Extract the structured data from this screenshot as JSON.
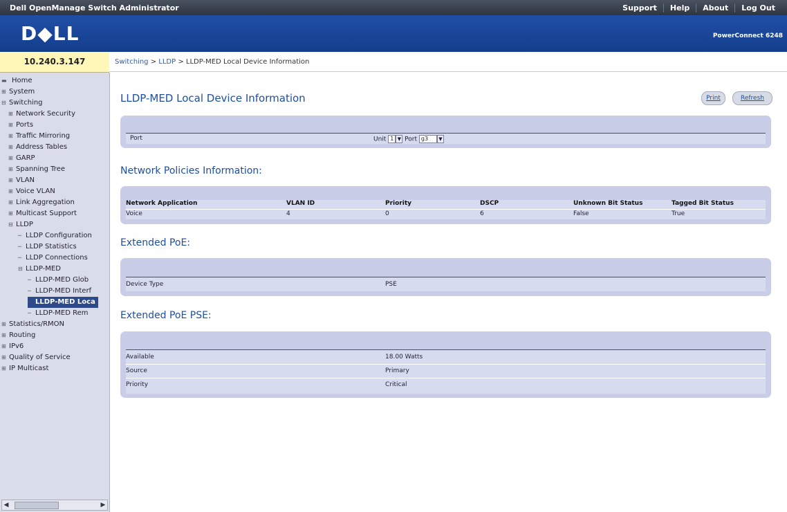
{
  "app": {
    "title": "Dell OpenManage Switch Administrator",
    "links": [
      "Support",
      "Help",
      "About",
      "Log Out"
    ],
    "logo": "D◆LL",
    "model": "PowerConnect 6248",
    "ip": "10.240.3.147"
  },
  "breadcrumb": {
    "parts": [
      "Switching",
      "LLDP",
      "LLDP-MED Local Device Information"
    ],
    "sep": " > "
  },
  "sidebar": {
    "items": [
      {
        "label": "Home",
        "indent": 0,
        "icon": "home-icon"
      },
      {
        "label": "System",
        "indent": 0,
        "icon": "expand-icon"
      },
      {
        "label": "Switching",
        "indent": 0,
        "icon": "collapse-icon"
      },
      {
        "label": "Network Security",
        "indent": 1,
        "icon": "expand-icon"
      },
      {
        "label": "Ports",
        "indent": 1,
        "icon": "expand-icon"
      },
      {
        "label": "Traffic Mirroring",
        "indent": 1,
        "icon": "expand-icon"
      },
      {
        "label": "Address Tables",
        "indent": 1,
        "icon": "expand-icon"
      },
      {
        "label": "GARP",
        "indent": 1,
        "icon": "expand-icon"
      },
      {
        "label": "Spanning Tree",
        "indent": 1,
        "icon": "expand-icon"
      },
      {
        "label": "VLAN",
        "indent": 1,
        "icon": "expand-icon"
      },
      {
        "label": "Voice VLAN",
        "indent": 1,
        "icon": "expand-icon"
      },
      {
        "label": "Link Aggregation",
        "indent": 1,
        "icon": "expand-icon"
      },
      {
        "label": "Multicast Support",
        "indent": 1,
        "icon": "expand-icon"
      },
      {
        "label": "LLDP",
        "indent": 1,
        "icon": "collapse-icon"
      },
      {
        "label": "LLDP Configuration",
        "indent": 2,
        "icon": ""
      },
      {
        "label": "LLDP Statistics",
        "indent": 2,
        "icon": ""
      },
      {
        "label": "LLDP Connections",
        "indent": 2,
        "icon": ""
      },
      {
        "label": "LLDP-MED",
        "indent": 2,
        "icon": "collapse-icon"
      },
      {
        "label": "LLDP-MED Glob",
        "indent": 3,
        "icon": ""
      },
      {
        "label": "LLDP-MED Interf",
        "indent": 3,
        "icon": ""
      },
      {
        "label": "LLDP-MED Loca",
        "indent": 3,
        "icon": "",
        "selected": true
      },
      {
        "label": "LLDP-MED Rem",
        "indent": 3,
        "icon": ""
      },
      {
        "label": "Statistics/RMON",
        "indent": 0,
        "icon": "expand-icon"
      },
      {
        "label": "Routing",
        "indent": 0,
        "icon": "expand-icon"
      },
      {
        "label": "IPv6",
        "indent": 0,
        "icon": "expand-icon"
      },
      {
        "label": "Quality of Service",
        "indent": 0,
        "icon": "expand-icon"
      },
      {
        "label": "IP Multicast",
        "indent": 0,
        "icon": "expand-icon"
      }
    ]
  },
  "page": {
    "title": "LLDP-MED Local Device Information",
    "print_label": "Print",
    "refresh_label": "Refresh"
  },
  "port_section": {
    "label": "Port",
    "unit_label": "Unit",
    "unit_value": "1",
    "port_label": "Port",
    "port_value": "g3"
  },
  "network_policies": {
    "heading": "Network Policies Information:",
    "columns": [
      "Network Application",
      "VLAN ID",
      "Priority",
      "DSCP",
      "Unknown Bit Status",
      "Tagged Bit Status"
    ],
    "rows": [
      [
        "Voice",
        "4",
        "0",
        "6",
        "False",
        "True"
      ]
    ]
  },
  "extended_poe": {
    "heading": "Extended PoE:",
    "device_type_label": "Device Type",
    "device_type_value": "PSE"
  },
  "extended_poe_pse": {
    "heading": "Extended PoE PSE:",
    "rows": [
      [
        "Available",
        "18.00  Watts"
      ],
      [
        "Source",
        "Primary"
      ],
      [
        "Priority",
        "Critical"
      ]
    ]
  }
}
